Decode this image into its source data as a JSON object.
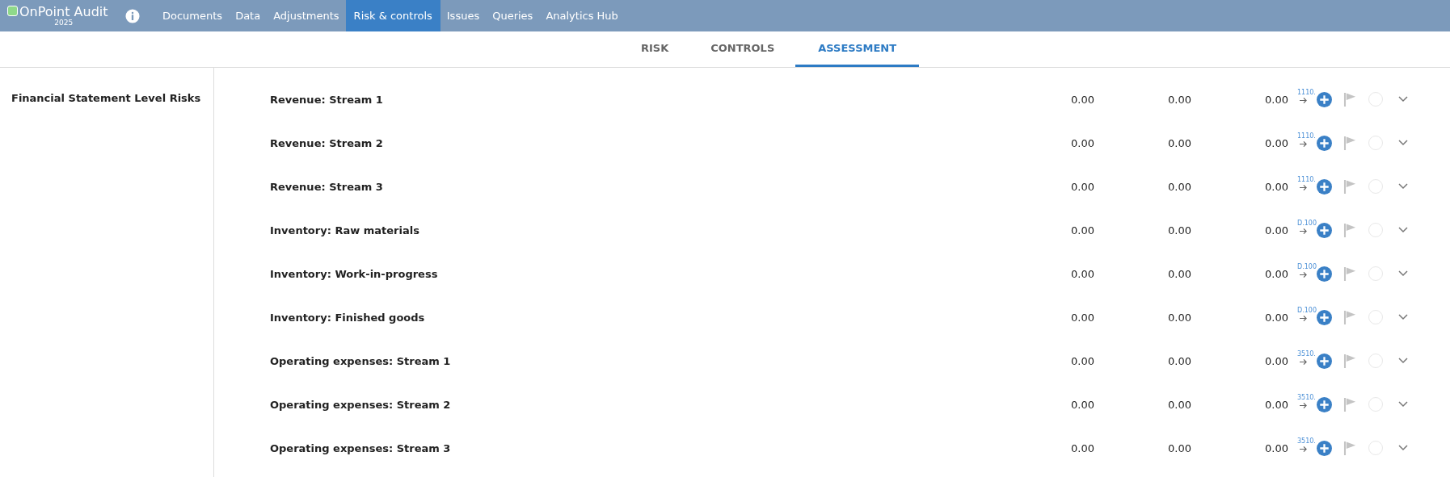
{
  "app": {
    "name": "OnPoint Audit",
    "year": "2025"
  },
  "nav": [
    {
      "label": "Documents",
      "selected": false
    },
    {
      "label": "Data",
      "selected": false
    },
    {
      "label": "Adjustments",
      "selected": false
    },
    {
      "label": "Risk & controls",
      "selected": true
    },
    {
      "label": "Issues",
      "selected": false
    },
    {
      "label": "Queries",
      "selected": false
    },
    {
      "label": "Analytics Hub",
      "selected": false
    }
  ],
  "tabs": [
    {
      "label": "RISK",
      "selected": false
    },
    {
      "label": "CONTROLS",
      "selected": false
    },
    {
      "label": "ASSESSMENT",
      "selected": true
    }
  ],
  "sidebar": {
    "title": "Financial Statement Level Risks"
  },
  "rows": [
    {
      "title": "Revenue: Stream 1",
      "values": [
        "0.00",
        "0.00",
        "0.00"
      ],
      "reference": "1110."
    },
    {
      "title": "Revenue: Stream 2",
      "values": [
        "0.00",
        "0.00",
        "0.00"
      ],
      "reference": "1110."
    },
    {
      "title": "Revenue: Stream 3",
      "values": [
        "0.00",
        "0.00",
        "0.00"
      ],
      "reference": "1110."
    },
    {
      "title": "Inventory: Raw materials",
      "values": [
        "0.00",
        "0.00",
        "0.00"
      ],
      "reference": "D.100"
    },
    {
      "title": "Inventory: Work-in-progress",
      "values": [
        "0.00",
        "0.00",
        "0.00"
      ],
      "reference": "D.100"
    },
    {
      "title": "Inventory: Finished goods",
      "values": [
        "0.00",
        "0.00",
        "0.00"
      ],
      "reference": "D.100"
    },
    {
      "title": "Operating expenses: Stream 1",
      "values": [
        "0.00",
        "0.00",
        "0.00"
      ],
      "reference": "3510."
    },
    {
      "title": "Operating expenses: Stream 2",
      "values": [
        "0.00",
        "0.00",
        "0.00"
      ],
      "reference": "3510."
    },
    {
      "title": "Operating expenses: Stream 3",
      "values": [
        "0.00",
        "0.00",
        "0.00"
      ],
      "reference": "3510."
    }
  ]
}
